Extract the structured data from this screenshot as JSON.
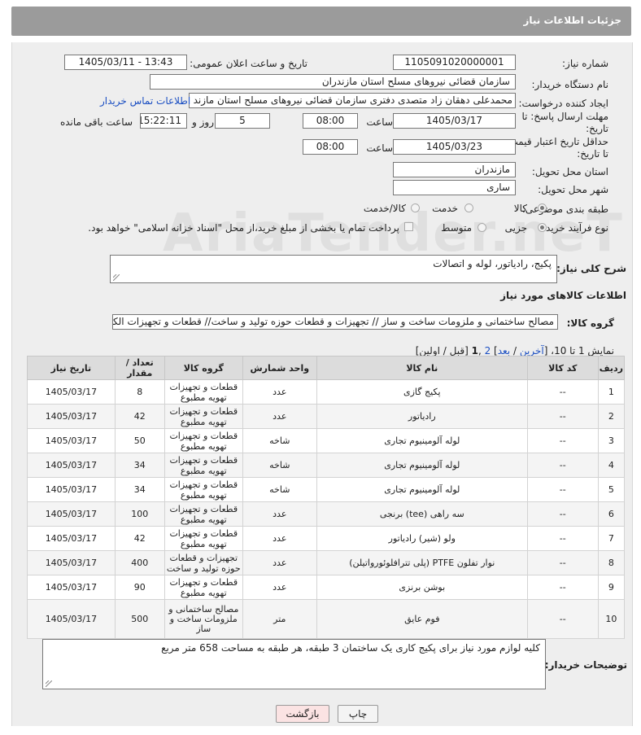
{
  "header": {
    "title": "جزئیات اطلاعات نیاز"
  },
  "form": {
    "need_number_label": "شماره نیاز:",
    "need_number": "1105091020000001",
    "announce_label": "تاریخ و ساعت اعلان عمومی:",
    "announce_value": "1405/03/11 - 13:43",
    "buyer_org_label": "نام دستگاه خریدار:",
    "buyer_org": "سازمان قضائی نیروهای مسلح استان مازندران",
    "creator_label": "ایجاد کننده درخواست:",
    "creator": "محمدعلی دهقان زاد متصدی دفتری سازمان قضائی نیروهای مسلح استان مازند",
    "contact_link": "اطلاعات تماس خریدار",
    "deadline_label_1": "مهلت ارسال پاسخ: تا",
    "deadline_label_2": "تاریخ:",
    "deadline_date": "1405/03/17",
    "time_label": "ساعت",
    "deadline_time": "08:00",
    "days_value": "5",
    "days_label": "روز و",
    "remaining_time": "15:22:11",
    "remaining_label": "ساعت باقی مانده",
    "validity_label_1": "حداقل تاریخ اعتبار قیمت:",
    "validity_label_2": "تا تاریخ:",
    "validity_date": "1405/03/23",
    "validity_time": "08:00",
    "province_label": "استان محل تحویل:",
    "province": "مازندران",
    "city_label": "شهر محل تحویل:",
    "city": "ساری",
    "category_label": "طبقه بندی موضوعی:",
    "category_options": [
      "کالا",
      "خدمت",
      "کالا/خدمت"
    ],
    "process_label": "نوع فرآیند خرید :",
    "process_options": [
      "جزیی",
      "متوسط"
    ],
    "payment_note": "پرداخت تمام یا بخشی از مبلغ خرید،از محل \"اسناد خزانه اسلامی\" خواهد بود.",
    "summary_label": "شرح کلی نیاز:",
    "summary": "پکیج، رادیاتور، لوله و اتصالات",
    "goods_info_title": "اطلاعات کالاهای مورد نیاز",
    "goods_group_label": "گروه کالا:",
    "goods_group": "مصالح ساختمانی و ملزومات ساخت و ساز // تجهیزات و قطعات حوزه تولید و ساخت// قطعات و تجهیزات الکتری"
  },
  "pagination": {
    "prefix": "نمایش 1 تا 10، [",
    "last": "آخرین",
    "sep1": " / ",
    "next": "بعد",
    "sep2": "] ",
    "page2": "2",
    "comma": " ,",
    "page1": "1",
    "suffix": " [قبل / اولین]"
  },
  "table": {
    "headers": [
      "ردیف",
      "کد کالا",
      "نام کالا",
      "واحد شمارش",
      "گروه کالا",
      "تعداد / مقدار",
      "تاریخ نیاز"
    ],
    "rows": [
      [
        "1",
        "--",
        "پکیج گازی",
        "عدد",
        "قطعات و تجهیزات تهویه مطبوع",
        "8",
        "1405/03/17"
      ],
      [
        "2",
        "--",
        "رادیاتور",
        "عدد",
        "قطعات و تجهیزات تهویه مطبوع",
        "42",
        "1405/03/17"
      ],
      [
        "3",
        "--",
        "لوله آلومینیوم تجاری",
        "شاخه",
        "قطعات و تجهیزات تهویه مطبوع",
        "50",
        "1405/03/17"
      ],
      [
        "4",
        "--",
        "لوله آلومینیوم تجاری",
        "شاخه",
        "قطعات و تجهیزات تهویه مطبوع",
        "34",
        "1405/03/17"
      ],
      [
        "5",
        "--",
        "لوله آلومینیوم تجاری",
        "شاخه",
        "قطعات و تجهیزات تهویه مطبوع",
        "34",
        "1405/03/17"
      ],
      [
        "6",
        "--",
        "سه راهی (tee) برنجی",
        "عدد",
        "قطعات و تجهیزات تهویه مطبوع",
        "100",
        "1405/03/17"
      ],
      [
        "7",
        "--",
        "ولو (شیر) رادیاتور",
        "عدد",
        "قطعات و تجهیزات تهویه مطبوع",
        "42",
        "1405/03/17"
      ],
      [
        "8",
        "--",
        "نوار تفلون PTFE (پلی تترافلوئورواتیلن)",
        "عدد",
        "تجهیزات و قطعات حوزه تولید و ساخت",
        "400",
        "1405/03/17"
      ],
      [
        "9",
        "--",
        "بوشن برنزی",
        "عدد",
        "قطعات و تجهیزات تهویه مطبوع",
        "90",
        "1405/03/17"
      ],
      [
        "10",
        "--",
        "فوم عایق",
        "متر",
        "مصالح ساختمانی و ملزومات ساخت و ساز",
        "500",
        "1405/03/17"
      ]
    ]
  },
  "buyer_notes_label": "توضیحات خریدار:",
  "buyer_notes": "کلیه لوازم مورد نیاز برای پکیج کاری یک ساختمان 3 طبقه، هر طبقه به مساحت 658 متر مربع",
  "buttons": {
    "print": "چاپ",
    "back": "بازگشت"
  },
  "watermark": "AriaTender.neT",
  "colors": {
    "header_bg": "#9b9b9b",
    "link": "#1a4ec2",
    "back_button": "#fbe3e3"
  }
}
